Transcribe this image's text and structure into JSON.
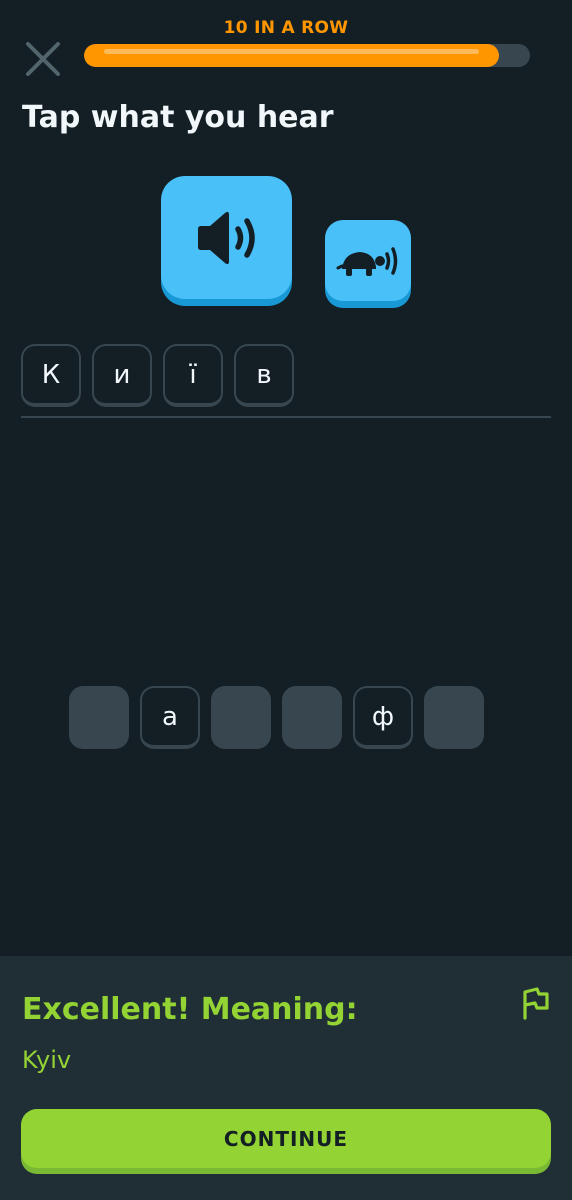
{
  "header": {
    "close_icon": "close-icon",
    "streak_label": "10 IN A ROW",
    "progress": 0.93,
    "progress_color": "#ff9600",
    "streak_color": "#ff9600"
  },
  "prompt": {
    "title": "Tap what you hear"
  },
  "audio": {
    "normal_icon": "speaker-icon",
    "slow_icon": "turtle-speaker-icon",
    "color": "#49c0f8"
  },
  "answer": {
    "tiles": [
      "К",
      "и",
      "ї",
      "в"
    ]
  },
  "word_bank": {
    "tiles": [
      {
        "label": "",
        "used": true
      },
      {
        "label": "а",
        "used": false
      },
      {
        "label": "",
        "used": true
      },
      {
        "label": "",
        "used": true
      },
      {
        "label": "ф",
        "used": false
      },
      {
        "label": "",
        "used": true
      }
    ]
  },
  "feedback": {
    "title": "Excellent! Meaning:",
    "meaning": "Kyiv",
    "flag_icon": "flag-icon",
    "continue_label": "CONTINUE",
    "accent": "#93d333"
  }
}
